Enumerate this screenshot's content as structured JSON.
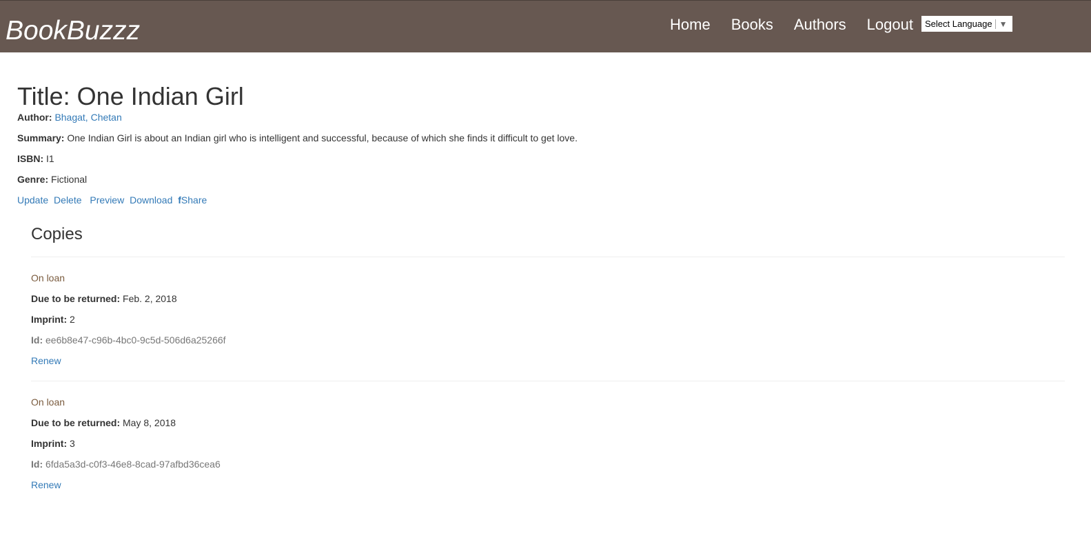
{
  "navbar": {
    "brand": "BookBuzzz",
    "links": [
      "Home",
      "Books",
      "Authors",
      "Logout"
    ],
    "language_select": "Select Language",
    "language_arrow": "▼"
  },
  "book": {
    "title": "Title: One Indian Girl",
    "author_label": "Author:",
    "author": "Bhagat, Chetan",
    "summary_label": "Summary:",
    "summary": "One Indian Girl is about an Indian girl who is intelligent and successful, because of which she finds it difficult to get love.",
    "isbn_label": "ISBN:",
    "isbn": "I1",
    "genre_label": "Genre:",
    "genre": "Fictional",
    "actions": {
      "update": "Update",
      "delete": "Delete",
      "preview": "Preview",
      "download": "Download",
      "share_icon": "f",
      "share": "Share"
    }
  },
  "copies": {
    "heading": "Copies",
    "due_label": "Due to be returned:",
    "imprint_label": "Imprint:",
    "id_label": "Id:",
    "renew_label": "Renew",
    "items": [
      {
        "status": "On loan",
        "due": "Feb. 2, 2018",
        "imprint": "2",
        "id": "ee6b8e47-c96b-4bc0-9c5d-506d6a25266f"
      },
      {
        "status": "On loan",
        "due": "May 8, 2018",
        "imprint": "3",
        "id": "6fda5a3d-c0f3-46e8-8cad-97afbd36cea6"
      }
    ]
  },
  "colors": {
    "navbar_bg": "#675851",
    "link": "#337ab7",
    "status": "#7a5b3e"
  }
}
